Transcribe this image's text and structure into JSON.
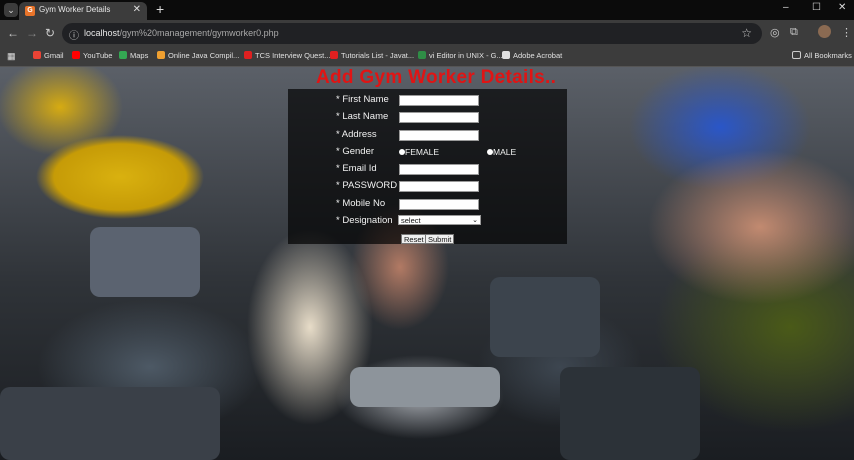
{
  "browser": {
    "tab_title": "Gym Worker Details",
    "tab_favicon_letter": "G",
    "new_tab": "+",
    "url_host": "localhost",
    "url_path": "/gym%20management/gymworker0.php",
    "window_controls": {
      "minimize": "–",
      "maximize": "☐",
      "close": "✕"
    }
  },
  "bookmarks": {
    "items": [
      {
        "label": "Gmail",
        "icon": "gmail-icon",
        "color": "#ea4335"
      },
      {
        "label": "YouTube",
        "icon": "youtube-icon",
        "color": "#ff0000"
      },
      {
        "label": "Maps",
        "icon": "maps-icon",
        "color": "#34a853"
      },
      {
        "label": "Online Java Compil...",
        "icon": "compiler-icon",
        "color": "#f0a030"
      },
      {
        "label": "TCS Interview Quest...",
        "icon": "tcs-icon",
        "color": "#e02020"
      },
      {
        "label": "Tutorials List - Javat...",
        "icon": "tutorials-icon",
        "color": "#e02020"
      },
      {
        "label": "vi Editor in UNIX - G...",
        "icon": "gfg-icon",
        "color": "#2f8d46"
      },
      {
        "label": "Adobe Acrobat",
        "icon": "acrobat-icon",
        "color": "#e0e0e0"
      }
    ],
    "all_bookmarks": "All Bookmarks"
  },
  "page": {
    "title": "Add Gym Worker Details..",
    "title_color": "#e01414",
    "fields": [
      {
        "label": "* First Name",
        "value": ""
      },
      {
        "label": "* Last Name",
        "value": ""
      },
      {
        "label": "* Address",
        "value": ""
      },
      {
        "label": "* Gender",
        "value": ""
      },
      {
        "label": "* Email Id",
        "value": ""
      },
      {
        "label": "* PASSWORD",
        "value": ""
      },
      {
        "label": "* Mobile No",
        "value": ""
      },
      {
        "label": "* Designation",
        "value": "select"
      }
    ],
    "gender_options": [
      "FEMALE",
      "MALE"
    ],
    "designation_selected": "select",
    "buttons": {
      "reset": "Reset",
      "submit": "Submit"
    }
  }
}
